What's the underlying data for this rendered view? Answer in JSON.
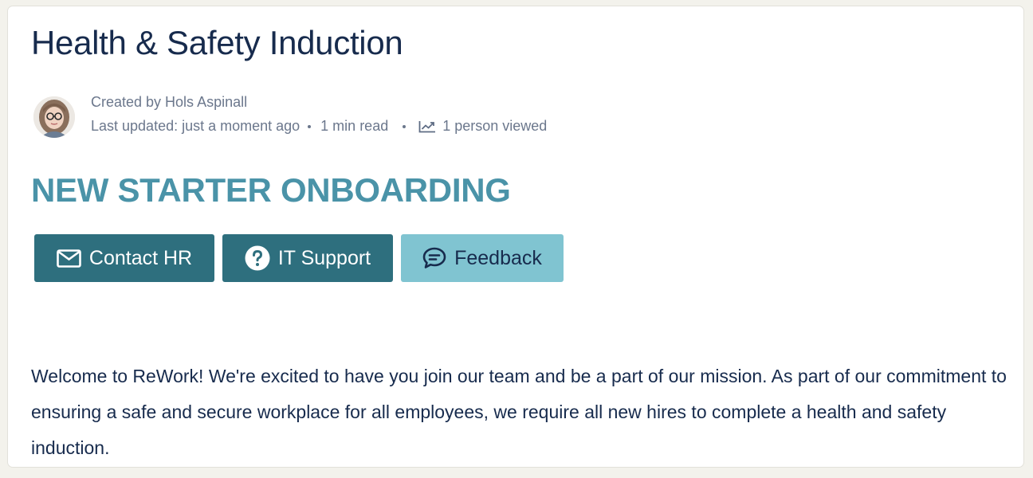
{
  "page": {
    "title": "Health & Safety Induction"
  },
  "byline": {
    "created_by": "Created by Hols Aspinall",
    "last_updated": "Last updated: just a moment ago",
    "read_time": "1 min read",
    "views": "1 person viewed"
  },
  "content": {
    "heading": "NEW STARTER ONBOARDING",
    "paragraph": "Welcome to ReWork! We're excited to have you join our team and be a part of our mission. As part of our commitment to ensuring a safe and secure workplace for all employees, we require all new hires to complete a health and safety induction."
  },
  "buttons": {
    "contact_hr": "Contact HR",
    "it_support": "IT Support",
    "feedback": "Feedback"
  },
  "icons": {
    "contact_hr": "envelope-icon",
    "it_support": "question-circle-icon",
    "feedback": "chat-bubble-icon",
    "views": "trend-chart-icon"
  },
  "colors": {
    "title": "#172b4d",
    "heading_accent": "#4a93a8",
    "button_dark": "#2e6f7e",
    "button_light": "#80c4d1",
    "meta_text": "#6b778c"
  }
}
